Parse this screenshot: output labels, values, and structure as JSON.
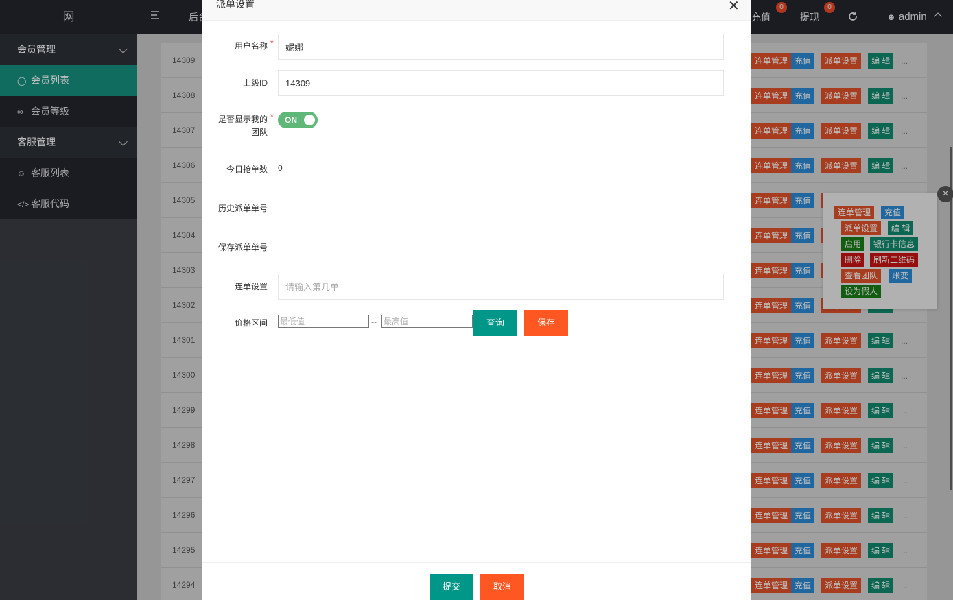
{
  "header": {
    "logo": "网",
    "breadcrumb": "后台",
    "recharge_label": "充值",
    "recharge_badge": "0",
    "withdraw_label": "提现",
    "withdraw_badge": "0",
    "admin_label": "admin"
  },
  "sidebar": {
    "groups": [
      {
        "label": "会员管理",
        "items": [
          {
            "label": "会员列表",
            "icon": "user-icon",
            "active": true
          },
          {
            "label": "会员等级",
            "icon": "link-icon"
          }
        ]
      },
      {
        "label": "客服管理",
        "items": [
          {
            "label": "客服列表",
            "icon": "users-icon"
          },
          {
            "label": "客服代码",
            "icon": "code-icon"
          }
        ]
      }
    ]
  },
  "table": {
    "row_ids": [
      "14309",
      "14308",
      "14307",
      "14306",
      "14305",
      "14304",
      "14303",
      "14302",
      "14301",
      "14300",
      "14299",
      "14298",
      "14297",
      "14296",
      "14295",
      "14294"
    ],
    "row_actions": [
      "连单管理",
      "充值",
      "派单设置",
      "编 辑"
    ],
    "more": "..."
  },
  "popover": {
    "actions": [
      "连单管理",
      "充值",
      "派单设置",
      "编 辑",
      "启用",
      "银行卡信息",
      "删除",
      "刷新二维码",
      "查看团队",
      "账变",
      "设为假人"
    ]
  },
  "modal": {
    "title": "派单设置",
    "fields": {
      "username_label": "用户名称",
      "username_value": "妮娜",
      "parent_label": "上级ID",
      "parent_value": "14309",
      "team_label_line1": "是否显示我的",
      "team_label_line2": "团队",
      "team_toggle_text": "ON",
      "today_label": "今日抢单数",
      "today_value": "0",
      "history_label": "历史派单单号",
      "saved_label": "保存派单单号",
      "chain_label": "连单设置",
      "chain_placeholder": "请输入第几单",
      "price_label": "价格区间",
      "price_min_placeholder": "最低值",
      "price_max_placeholder": "最高值",
      "price_sep": "--"
    },
    "query_button": "查询",
    "save_button": "保存",
    "submit_button": "提交",
    "cancel_button": "取消"
  },
  "colors": {
    "accent_teal": "#009688",
    "accent_orange": "#ff5722",
    "sidebar_active": "#16907f",
    "action_red": "#e0502a",
    "action_blue": "#2d8ad5",
    "action_green": "#0f8a6c"
  }
}
